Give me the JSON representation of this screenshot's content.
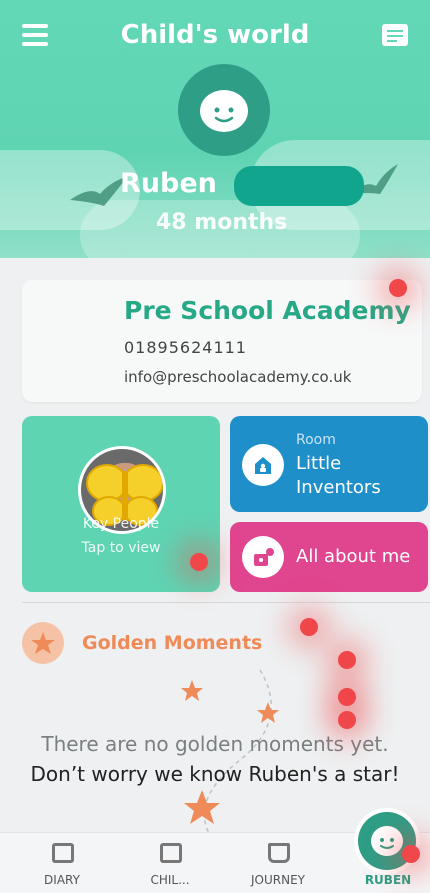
{
  "header": {
    "title": "Child's world",
    "child_name": "Ruben",
    "child_age": "48 months",
    "colors": {
      "primary": "#5fd4b3",
      "dark": "#2e9e86"
    }
  },
  "school": {
    "name": "Pre School Academy",
    "phone": "01895624111",
    "email": "info@preschoolacademy.co.uk"
  },
  "key_people": {
    "line1": "Key People",
    "line2": "Tap to view"
  },
  "room": {
    "caption": "Room",
    "name": "Little Inventors"
  },
  "about": {
    "label": "All about me"
  },
  "golden_moments": {
    "title": "Golden Moments",
    "empty_line1": "There are no golden moments yet.",
    "empty_line2": "Don’t worry we know Ruben's a star!"
  },
  "nav": {
    "items": [
      {
        "label": "DIARY",
        "icon": "diary-icon"
      },
      {
        "label": "CHIL...",
        "icon": "children-icon"
      },
      {
        "label": "JOURNEY",
        "icon": "journey-book-icon"
      },
      {
        "label": "RUBEN",
        "icon": "child-avatar-icon"
      }
    ]
  }
}
